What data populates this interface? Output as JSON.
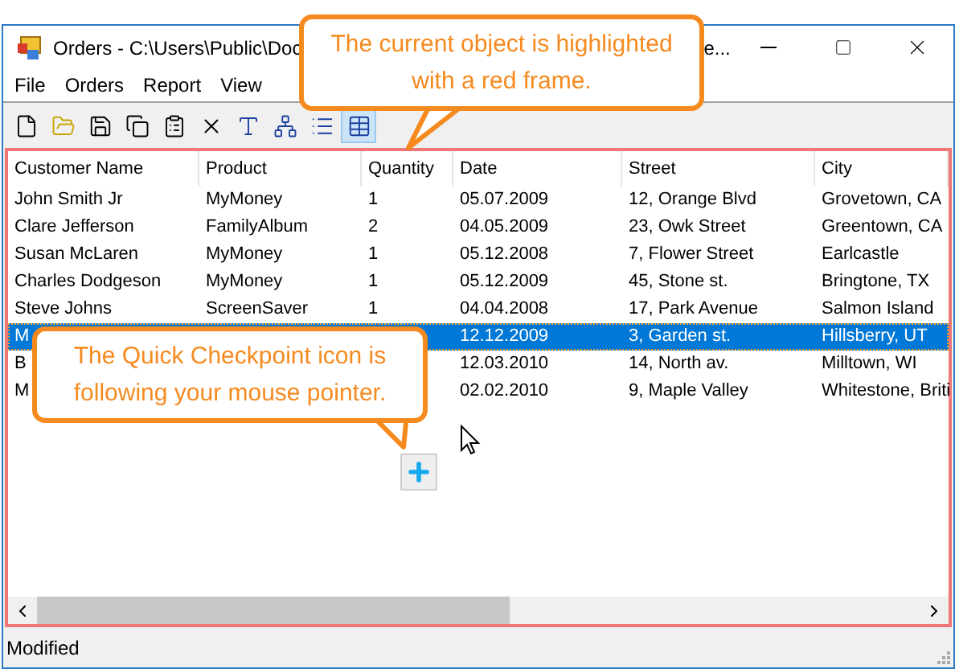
{
  "window": {
    "title": "Orders - C:\\Users\\Public\\Doc",
    "title_tail": "e..."
  },
  "menu": [
    "File",
    "Orders",
    "Report",
    "View"
  ],
  "toolbar": [
    {
      "kind": "new",
      "selected": false
    },
    {
      "kind": "open",
      "selected": false
    },
    {
      "kind": "save",
      "selected": false
    },
    {
      "kind": "copy",
      "selected": false
    },
    {
      "kind": "properties",
      "selected": false
    },
    {
      "kind": "delete",
      "selected": false
    },
    {
      "kind": "small-icons",
      "selected": false
    },
    {
      "kind": "tree",
      "selected": false
    },
    {
      "kind": "list",
      "selected": false
    },
    {
      "kind": "details",
      "selected": true
    }
  ],
  "table": {
    "columns": [
      "Customer Name",
      "Product",
      "Quantity",
      "Date",
      "Street",
      "City"
    ],
    "rows": [
      {
        "cells": [
          "John Smith Jr",
          "MyMoney",
          "1",
          "05.07.2009",
          "12, Orange Blvd",
          "Grovetown, CA"
        ],
        "selected": false
      },
      {
        "cells": [
          "Clare Jefferson",
          "FamilyAlbum",
          "2",
          "04.05.2009",
          "23, Owk Street",
          "Greentown, CA"
        ],
        "selected": false
      },
      {
        "cells": [
          "Susan McLaren",
          "MyMoney",
          "1",
          "05.12.2008",
          "7, Flower Street",
          "Earlcastle"
        ],
        "selected": false
      },
      {
        "cells": [
          "Charles Dodgeson",
          "MyMoney",
          "1",
          "05.12.2009",
          "45, Stone st.",
          "Bringtone, TX"
        ],
        "selected": false
      },
      {
        "cells": [
          "Steve Johns",
          "ScreenSaver",
          "1",
          "04.04.2008",
          "17, Park Avenue",
          "Salmon Island"
        ],
        "selected": false
      },
      {
        "cells": [
          "M",
          "",
          "",
          "12.12.2009",
          "3, Garden st.",
          "Hillsberry, UT"
        ],
        "selected": true
      },
      {
        "cells": [
          "B",
          "",
          "",
          "12.03.2010",
          "14, North av.",
          "Milltown, WI"
        ],
        "selected": false
      },
      {
        "cells": [
          "M",
          "",
          "",
          "02.02.2010",
          "9, Maple Valley",
          "Whitestone, Briti"
        ],
        "selected": false
      }
    ]
  },
  "callouts": [
    {
      "text": "The current object is highlighted with a red frame."
    },
    {
      "text": "The Quick Checkpoint icon is following your mouse pointer."
    }
  ],
  "status_bar": {
    "text": "Modified"
  }
}
